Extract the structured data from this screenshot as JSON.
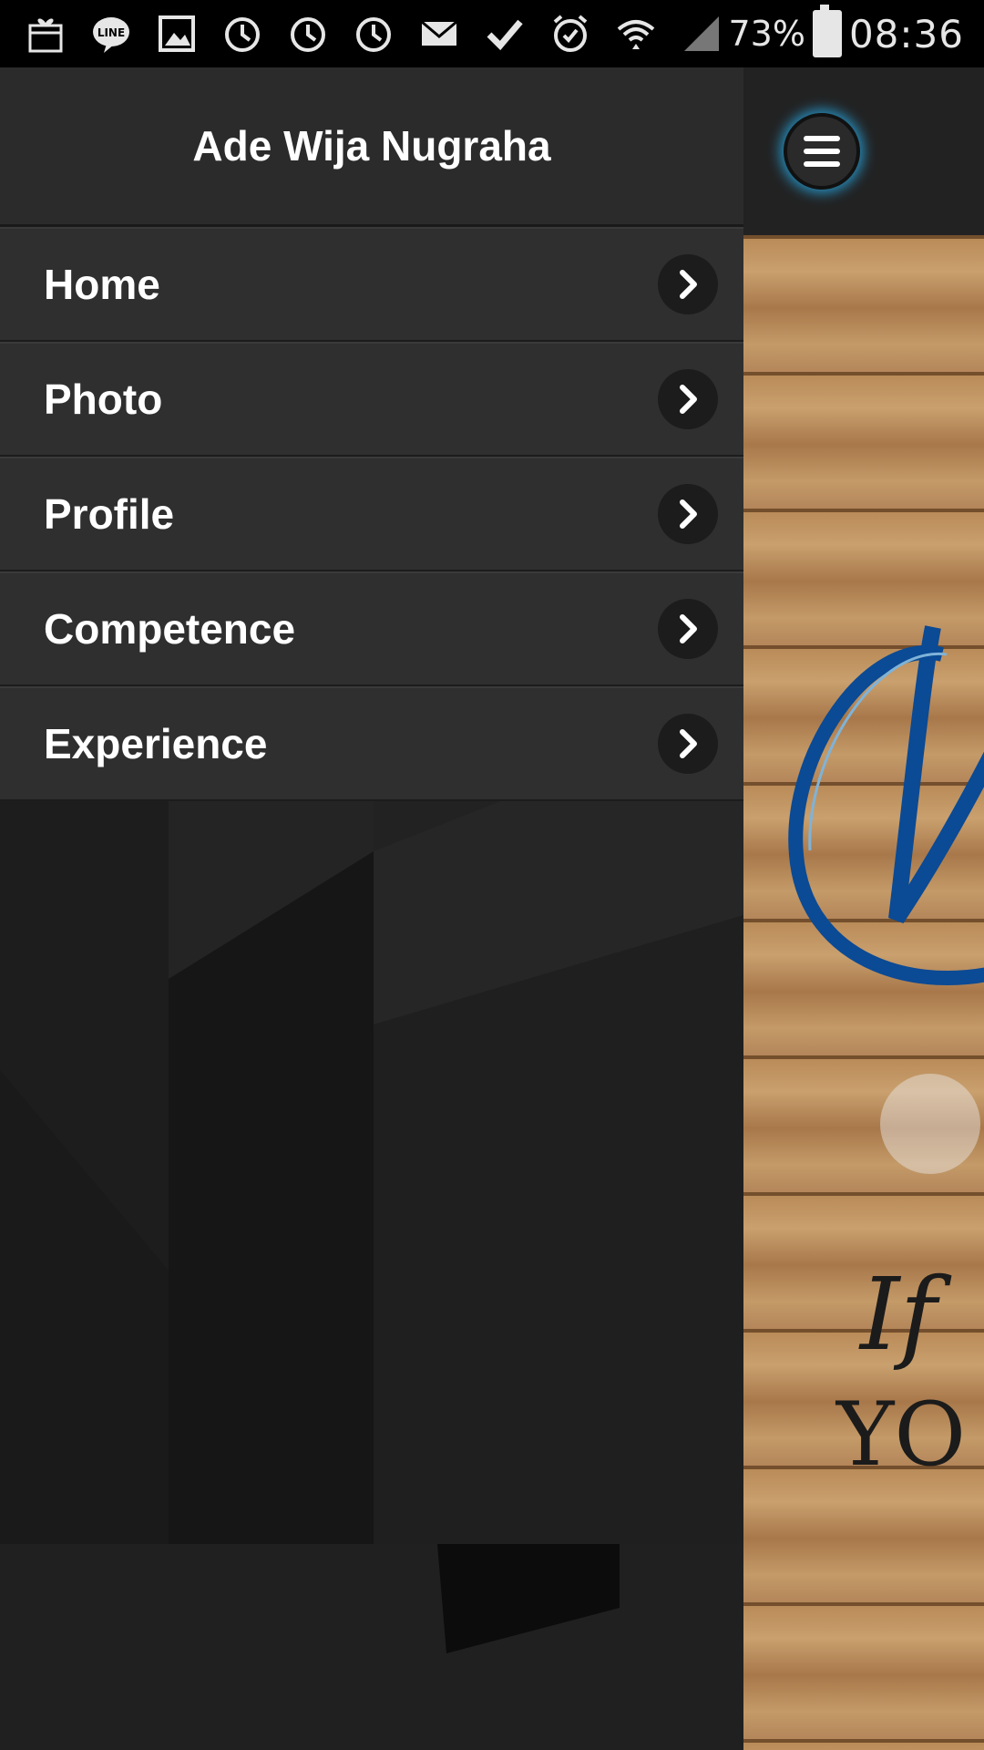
{
  "status_bar": {
    "icons": [
      "gift-icon",
      "line-icon",
      "image-icon",
      "clock-icon",
      "clock-icon",
      "clock-icon",
      "mail-icon",
      "check-icon",
      "alarm-icon",
      "wifi-icon",
      "signal-icon"
    ],
    "battery": "73%",
    "time": "08:36"
  },
  "drawer": {
    "title": "Ade Wija Nugraha",
    "items": [
      {
        "label": "Home"
      },
      {
        "label": "Photo"
      },
      {
        "label": "Profile"
      },
      {
        "label": "Competence"
      },
      {
        "label": "Experience"
      }
    ]
  },
  "content": {
    "partial_text": "YO",
    "script_text": "If"
  },
  "colors": {
    "accent_glow": "#28aae6",
    "drawer_item_bg": "#2f2f2f",
    "header_bg": "#2b2b2b",
    "script_blue": "#0b4a94"
  }
}
